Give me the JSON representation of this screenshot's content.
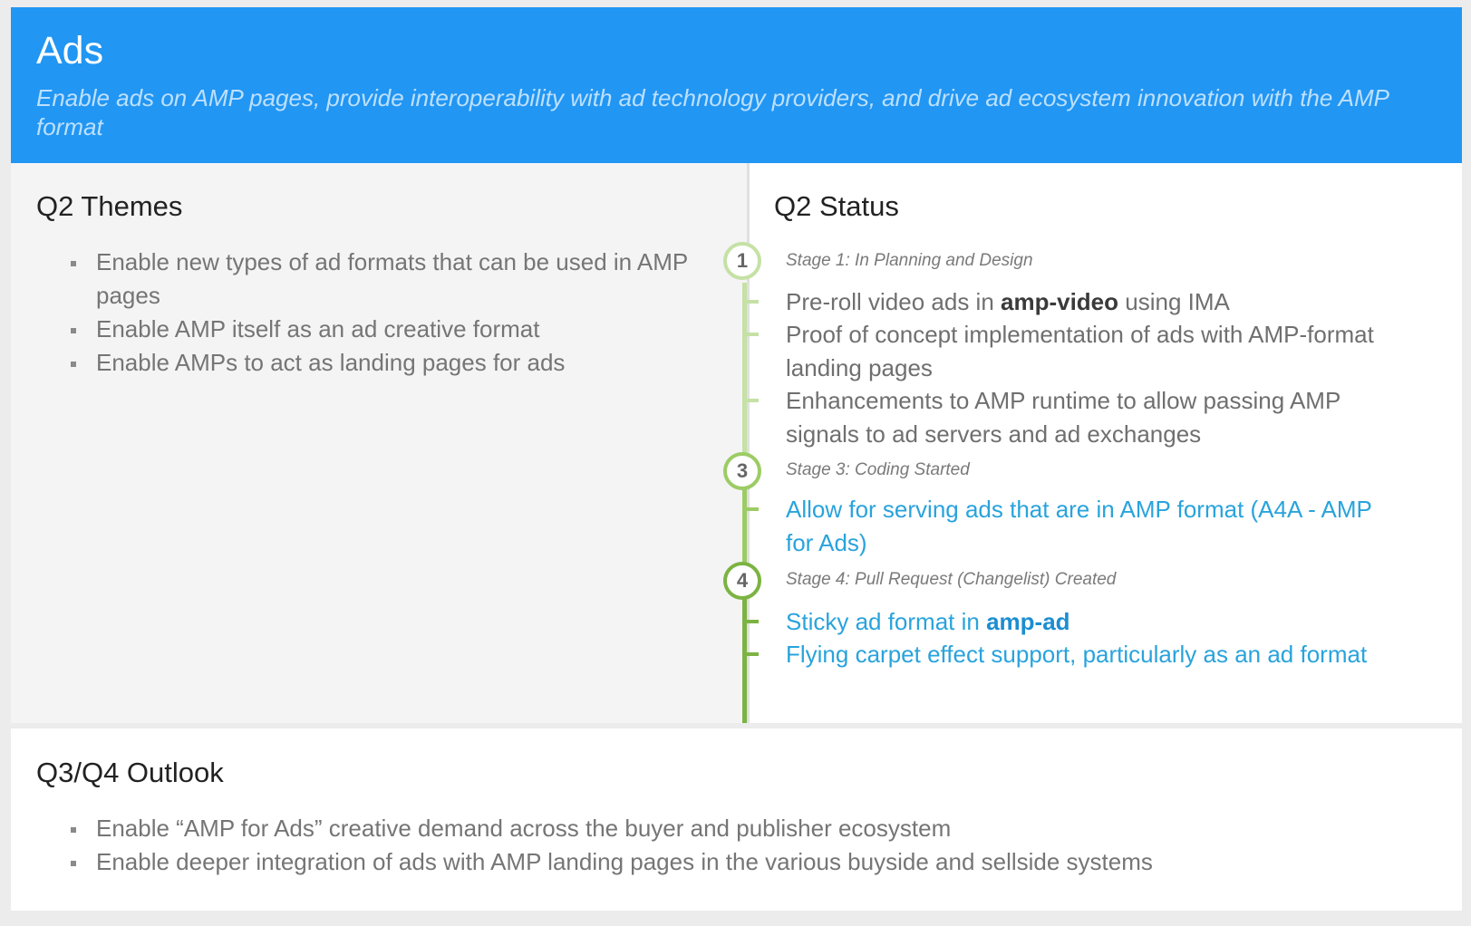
{
  "header": {
    "title": "Ads",
    "subtitle": "Enable ads on AMP pages, provide interoperability with ad technology providers, and drive ad ecosystem innovation with the AMP format"
  },
  "themes": {
    "title": "Q2 Themes",
    "items": [
      "Enable new types of ad formats that can be used in AMP pages",
      "Enable AMP itself as an ad creative format",
      "Enable AMPs to act as landing pages for ads"
    ]
  },
  "status": {
    "title": "Q2 Status",
    "stages": [
      {
        "number": "1",
        "label": "Stage 1: In Planning and Design",
        "color": "#c5e1a5",
        "items": [
          {
            "pre": "Pre-roll video ads in ",
            "bold": "amp-video",
            "post": " using IMA"
          },
          {
            "pre": "Proof of concept implementation of ads with AMP-format landing pages",
            "bold": "",
            "post": ""
          },
          {
            "pre": "Enhancements to AMP runtime to allow passing AMP signals to ad servers and ad exchanges",
            "bold": "",
            "post": ""
          }
        ]
      },
      {
        "number": "3",
        "label": "Stage 3: Coding Started",
        "color": "#9ccc65",
        "items": [
          {
            "pre": "Allow for serving ads that are in AMP format (A4A - AMP for Ads)",
            "bold": "",
            "post": ""
          }
        ]
      },
      {
        "number": "4",
        "label": "Stage 4: Pull Request (Changelist) Created",
        "color": "#7cb342",
        "items": [
          {
            "pre": "Sticky ad format in ",
            "bold": "amp-ad",
            "post": ""
          },
          {
            "pre": "Flying carpet effect support, particularly as an ad format",
            "bold": "",
            "post": ""
          }
        ]
      }
    ]
  },
  "outlook": {
    "title": "Q3/Q4 Outlook",
    "items": [
      "Enable “AMP for Ads” creative demand across the buyer and publisher ecosystem",
      "Enable deeper integration of ads with AMP landing pages in the various buyside and sellside systems"
    ]
  },
  "colors": {
    "header_bg": "#2196f3",
    "link_blue": "#29a3dc"
  }
}
